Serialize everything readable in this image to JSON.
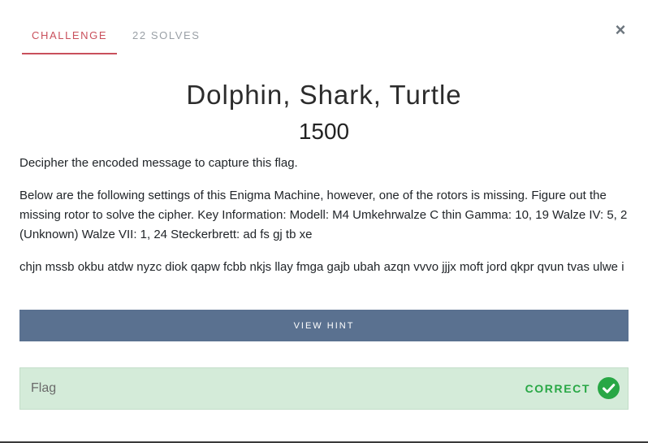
{
  "tabs": [
    {
      "label": "CHALLENGE",
      "active": true
    },
    {
      "label": "22 SOLVES",
      "active": false
    }
  ],
  "close_symbol": "×",
  "challenge": {
    "title": "Dolphin, Shark, Turtle",
    "value": "1500",
    "description_1": "Decipher the encoded message to capture this flag.",
    "description_2": "Below are the following settings of this Enigma Machine, however, one of the rotors is missing. Figure out the missing rotor to solve the cipher. Key Information: Modell: M4 Umkehrwalze C thin Gamma: 10, 19 Walze IV: 5, 2 (Unknown) Walze VII: 1, 24 Steckerbrett: ad fs gj tb xe",
    "ciphertext": "chjn mssb okbu atdw nyzc diok qapw fcbb nkjs llay fmga gajb ubah azqn vvvo jjjx moft jord qkpr qvun tvas ulwe i"
  },
  "hint_button_label": "VIEW HINT",
  "flag": {
    "placeholder": "Flag",
    "status": "CORRECT",
    "status_icon": "check-circle-icon"
  },
  "colors": {
    "accent_active_tab": "#c9505c",
    "hint_button": "#5a7190",
    "correct_bg": "#d4ebd9",
    "correct_text": "#28a745"
  }
}
